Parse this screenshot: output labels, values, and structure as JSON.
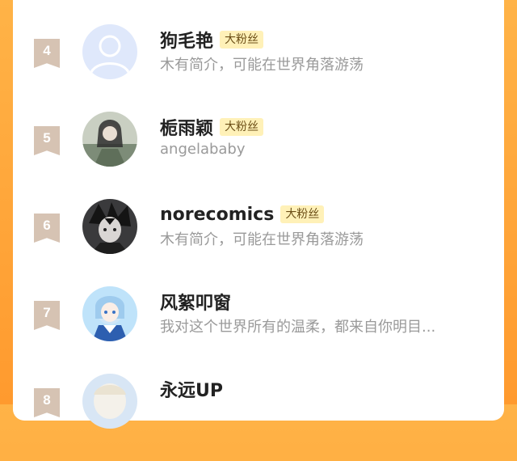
{
  "rows": [
    {
      "rank": "4",
      "name": "狗毛艳",
      "badge": "大粉丝",
      "desc": "木有简介，可能在世界角落游荡",
      "avatar": "default-avatar"
    },
    {
      "rank": "5",
      "name": "栀雨颖",
      "badge": "大粉丝",
      "desc": "angelababy",
      "avatar": "user-avatar"
    },
    {
      "rank": "6",
      "name": "norecomics",
      "badge": "大粉丝",
      "desc": "木有简介，可能在世界角落游荡",
      "avatar": "user-avatar"
    },
    {
      "rank": "7",
      "name": "风絮叩窗",
      "badge": "",
      "desc": "我对这个世界所有的温柔，都来自你明目...",
      "avatar": "user-avatar"
    },
    {
      "rank": "8",
      "name": "永远UP",
      "badge": "",
      "desc": "",
      "avatar": "user-avatar"
    }
  ],
  "colors": {
    "background": "#ff9a2e",
    "card": "#ffffff",
    "rank_badge": "#d6c3b3",
    "fan_badge_bg": "#fff1b8",
    "fan_badge_text": "#6b4e16"
  }
}
